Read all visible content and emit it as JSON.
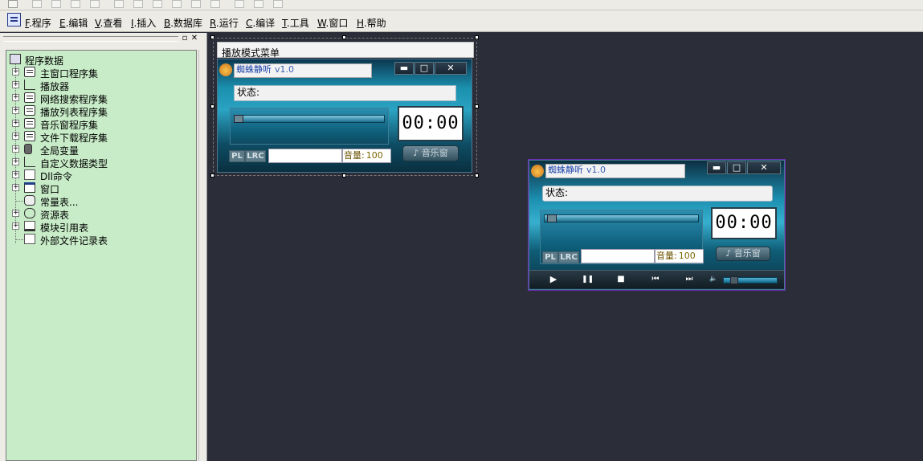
{
  "menubar": {
    "items": [
      {
        "key": "F",
        "label": ".程序"
      },
      {
        "key": "E",
        "label": ".编辑"
      },
      {
        "key": "V",
        "label": ".查看"
      },
      {
        "key": "I",
        "label": ".插入"
      },
      {
        "key": "B",
        "label": ".数据库"
      },
      {
        "key": "R",
        "label": ".运行"
      },
      {
        "key": "C",
        "label": ".编译"
      },
      {
        "key": "T",
        "label": ".工具"
      },
      {
        "key": "W",
        "label": ".窗口"
      },
      {
        "key": "H",
        "label": ".帮助"
      }
    ]
  },
  "panel": {
    "pin_label": "▫",
    "close_label": "✕"
  },
  "tree": {
    "root": "程序数据",
    "items": [
      {
        "label": "主窗口程序集",
        "icon": "stack-icon",
        "expandable": true
      },
      {
        "label": "播放器",
        "icon": "tree-icon",
        "expandable": true
      },
      {
        "label": "网络搜索程序集",
        "icon": "stack-icon",
        "expandable": true
      },
      {
        "label": "播放列表程序集",
        "icon": "stack-icon",
        "expandable": true
      },
      {
        "label": "音乐窗程序集",
        "icon": "stack-icon",
        "expandable": true
      },
      {
        "label": "文件下载程序集",
        "icon": "stack-icon",
        "expandable": true
      },
      {
        "label": "全局变量",
        "icon": "database-icon",
        "expandable": true
      },
      {
        "label": "自定义数据类型",
        "icon": "tree-icon",
        "expandable": true
      },
      {
        "label": "Dll命令",
        "icon": "dll-icon",
        "expandable": true
      },
      {
        "label": "窗口",
        "icon": "window-icon",
        "expandable": true
      },
      {
        "label": "常量表...",
        "icon": "constants-icon",
        "expandable": false
      },
      {
        "label": "资源表",
        "icon": "resource-icon",
        "expandable": true
      },
      {
        "label": "模块引用表",
        "icon": "module-icon",
        "expandable": true
      },
      {
        "label": "外部文件记录表",
        "icon": "doc-icon",
        "expandable": false
      }
    ]
  },
  "design_window": {
    "menu_label": "播放模式菜单",
    "title": "蜘蛛静听",
    "version": "v1.0",
    "status": "状态:",
    "time": "00:00",
    "music_btn": "♪ 音乐窗",
    "pl": "PL",
    "lrc": "LRC",
    "volume_label": "音量:",
    "volume_value": "100"
  },
  "preview_window": {
    "title": "蜘蛛静听",
    "version": "v1.0",
    "status": "状态:",
    "time": "00:00",
    "music_btn": "♪ 音乐窗",
    "pl": "PL",
    "lrc": "LRC",
    "volume_label": "音量:",
    "volume_value": "100",
    "seek_position": 0.02,
    "volume_level": 0.15
  },
  "window_buttons": {
    "minimize": "▬",
    "maximize": "□",
    "close": "✕"
  },
  "controls": {
    "play": "▶",
    "pause": "❚❚",
    "stop": "■",
    "prev": "⏮",
    "next": "⏭",
    "volume_icon": "🔈"
  },
  "colors": {
    "canvas_bg": "#2b2d38",
    "tree_bg": "#c8ecc8",
    "selection": "#6b2bb5"
  }
}
